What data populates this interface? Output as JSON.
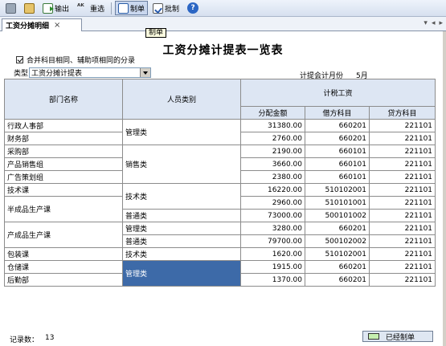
{
  "toolbar": {
    "export_label": "输出",
    "reselect_label": "重选",
    "make_label": "制单",
    "approve_label": "批制",
    "reselect_glyph": "ᴬᴷ"
  },
  "tab": {
    "label": "工资分摊明细",
    "close": "×",
    "nav": [
      "▾",
      "◂",
      "▸"
    ]
  },
  "tooltip": "制单",
  "title": "工资分摊计提表一览表",
  "merge_option_label": "合并科目相同、辅助项相同的分录",
  "type_label": "类型",
  "type_value": "工资分摊计提表",
  "period_label": "计提会计月份",
  "period_value": "5月",
  "table": {
    "headers": {
      "dept": "部门名称",
      "category": "人员类别",
      "group": "计税工资",
      "amount": "分配金额",
      "debit": "借方科目",
      "credit": "贷方科目"
    },
    "rows": [
      {
        "dept": "行政人事部",
        "category": "管理类",
        "amount": "31380.00",
        "debit": "660201",
        "credit": "221101"
      },
      {
        "dept": "财务部",
        "category": "",
        "amount": "2760.00",
        "debit": "660201",
        "credit": "221101"
      },
      {
        "dept": "采购部",
        "category": "",
        "amount": "2190.00",
        "debit": "660101",
        "credit": "221101"
      },
      {
        "dept": "产品销售组",
        "category": "销售类",
        "amount": "3660.00",
        "debit": "660101",
        "credit": "221101"
      },
      {
        "dept": "广告策划组",
        "category": "",
        "amount": "2380.00",
        "debit": "660101",
        "credit": "221101"
      },
      {
        "dept": "技术课",
        "category": "技术类",
        "amount": "16220.00",
        "debit": "510102001",
        "credit": "221101"
      },
      {
        "dept": "半成品生产课",
        "category": "",
        "amount": "2960.00",
        "debit": "510101001",
        "credit": "221101"
      },
      {
        "dept": "",
        "category": "普通类",
        "amount": "73000.00",
        "debit": "500101002",
        "credit": "221101"
      },
      {
        "dept": "产成品生产课",
        "category": "管理类",
        "amount": "3280.00",
        "debit": "660201",
        "credit": "221101"
      },
      {
        "dept": "",
        "category": "普通类",
        "amount": "79700.00",
        "debit": "500102002",
        "credit": "221101"
      },
      {
        "dept": "包装课",
        "category": "技术类",
        "amount": "1620.00",
        "debit": "510102001",
        "credit": "221101"
      },
      {
        "dept": "仓储课",
        "category": "管理类",
        "amount": "1915.00",
        "debit": "660201",
        "credit": "221101"
      },
      {
        "dept": "后勤部",
        "category": "",
        "amount": "1370.00",
        "debit": "660201",
        "credit": "221101"
      }
    ]
  },
  "footer": {
    "record_label": "记录数：",
    "record_count": "13",
    "status_label": "已经制单"
  },
  "colors": {
    "selected": "#3d6aa8",
    "header": "#dde6f3",
    "status_swatch": "#c6efb0"
  }
}
